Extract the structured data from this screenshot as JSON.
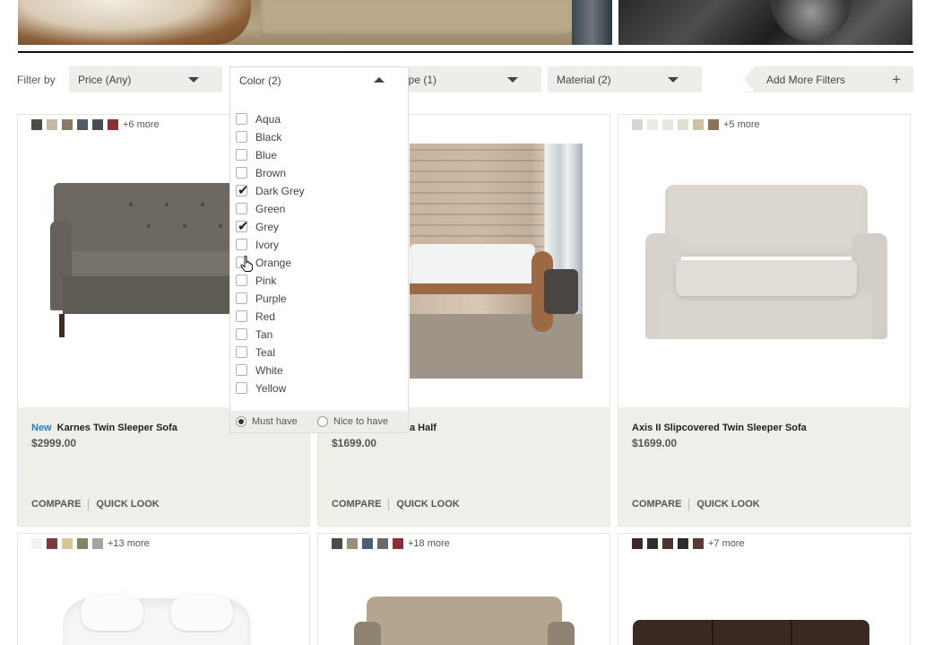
{
  "filter_bar": {
    "label": "Filter by",
    "filters": [
      {
        "id": "price",
        "label": "Price (Any)"
      },
      {
        "id": "color",
        "label": "Color (2)"
      },
      {
        "id": "type",
        "label": "Type (1)"
      },
      {
        "id": "material",
        "label": "Material (2)"
      }
    ],
    "add_more": "Add More Filters",
    "add_icon": "plus-icon"
  },
  "color_dropdown": {
    "options": [
      {
        "label": "Aqua",
        "checked": false
      },
      {
        "label": "Black",
        "checked": false
      },
      {
        "label": "Blue",
        "checked": false
      },
      {
        "label": "Brown",
        "checked": false
      },
      {
        "label": "Dark Grey",
        "checked": true
      },
      {
        "label": "Green",
        "checked": false
      },
      {
        "label": "Grey",
        "checked": true
      },
      {
        "label": "Ivory",
        "checked": false
      },
      {
        "label": "Orange",
        "checked": false
      },
      {
        "label": "Pink",
        "checked": false
      },
      {
        "label": "Purple",
        "checked": false
      },
      {
        "label": "Red",
        "checked": false
      },
      {
        "label": "Tan",
        "checked": false
      },
      {
        "label": "Teal",
        "checked": false
      },
      {
        "label": "White",
        "checked": false
      },
      {
        "label": "Yellow",
        "checked": false
      }
    ],
    "match_modes": [
      {
        "label": "Must have",
        "selected": true
      },
      {
        "label": "Nice to have",
        "selected": false
      }
    ]
  },
  "products": [
    {
      "badge": "New",
      "name": "Karnes Twin Sleeper Sofa",
      "price": "$2999.00",
      "swatches": [
        "#4e4b47",
        "#c6b8a2",
        "#8c7a64",
        "#545a66",
        "#4a4d58",
        "#8b2f33"
      ],
      "more": "+6 more",
      "compare": "COMPARE",
      "quick_look": "QUICK LOOK"
    },
    {
      "badge": "",
      "name": "a Half",
      "price": "$1699.00",
      "swatches": [],
      "more": "",
      "compare": "COMPARE",
      "quick_look": "QUICK LOOK"
    },
    {
      "badge": "",
      "name": "Axis II Slipcovered Twin Sleeper Sofa",
      "price": "$1699.00",
      "swatches": [
        "#d9d6cf",
        "#ecebe5",
        "#e7e8e2",
        "#e0ddd3",
        "#cfc2a3",
        "#8a7356"
      ],
      "more": "+5 more",
      "compare": "COMPARE",
      "quick_look": "QUICK LOOK"
    },
    {
      "swatches": [
        "#f4f3ef",
        "#7a3b3a",
        "#d8c890",
        "#858266",
        "#a5a49d"
      ],
      "more": "+13 more"
    },
    {
      "swatches": [
        "#4a4a48",
        "#9f8c78",
        "#4c5d75",
        "#6a6a6a",
        "#8b2f3a"
      ],
      "more": "+18 more"
    },
    {
      "swatches": [
        "#3b2a25",
        "#2f2f2f",
        "#473530",
        "#2c2c2c",
        "#5a3a33"
      ],
      "more": "+7 more"
    }
  ]
}
